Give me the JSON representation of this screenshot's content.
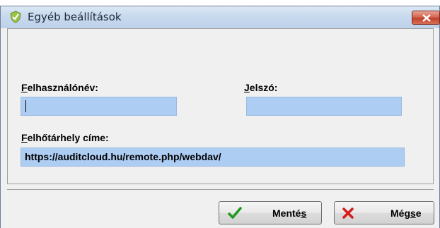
{
  "window": {
    "title": "Egyéb beállítások",
    "close_symbol": "x"
  },
  "form": {
    "username": {
      "label_first": "F",
      "label_rest": "elhasználónév:",
      "value": ""
    },
    "password": {
      "label_first": "J",
      "label_rest": "elszó:",
      "value": ""
    },
    "cloud_address": {
      "label_first": "F",
      "label_rest": "elhőtárhely címe:",
      "value": "https://auditcloud.hu/remote.php/webdav/"
    }
  },
  "buttons": {
    "save": {
      "label_pre": "Menté",
      "label_underline": "s",
      "label_post": "",
      "icon": "green-check-icon"
    },
    "cancel": {
      "label_pre": "Még",
      "label_underline": "s",
      "label_post": "e",
      "icon": "red-x-icon"
    }
  },
  "colors": {
    "field_bg": "#aecdf3",
    "title_bar": "#c9daee",
    "close_button": "#c2412b",
    "check_green": "#1d9a1d",
    "cross_red": "#d61b1b"
  }
}
